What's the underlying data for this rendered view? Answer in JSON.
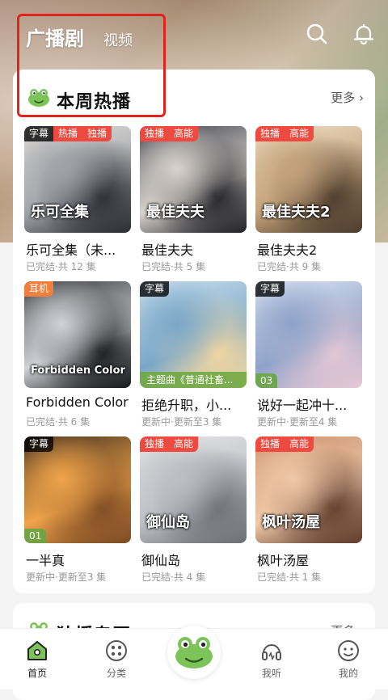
{
  "header": {
    "tab_active": "广播剧",
    "tab_other": "视频"
  },
  "section_hot": {
    "title": "本周热播",
    "more": "更多"
  },
  "section_next": {
    "title": "独播专区",
    "more": "更多"
  },
  "dramas": [
    {
      "title": "乐可全集（未...",
      "meta": "已完结·共 12 集",
      "tags": [
        {
          "text": "字幕",
          "color": "black"
        },
        {
          "text": "热播",
          "color": "red"
        },
        {
          "text": "独播",
          "color": "red"
        }
      ],
      "cover_text": "乐可全集",
      "art": [
        "#e9e4df",
        "#9fa3a8",
        "#2b2b33"
      ]
    },
    {
      "title": "最佳夫夫",
      "meta": "已完结·共 5 集",
      "tags": [
        {
          "text": "独播",
          "color": "red"
        },
        {
          "text": "高能",
          "color": "red"
        }
      ],
      "cover_text": "最佳夫夫",
      "art": [
        "#3b3f4a",
        "#d9d3cc",
        "#1f2026"
      ]
    },
    {
      "title": "最佳夫夫2",
      "meta": "已完结·共 9 集",
      "tags": [
        {
          "text": "独播",
          "color": "red"
        },
        {
          "text": "高能",
          "color": "red"
        }
      ],
      "cover_text": "最佳夫夫2",
      "art": [
        "#efe2c9",
        "#c4a27a",
        "#4a3b2c"
      ]
    },
    {
      "title": "Forbidden Color",
      "meta": "已完结·共 6 集",
      "tags": [
        {
          "text": "耳机",
          "color": "orange"
        }
      ],
      "cover_text": "Forbidden Color",
      "art": [
        "#2f2f33",
        "#cfd2d6",
        "#15161a"
      ]
    },
    {
      "title": "拒绝升职，小...",
      "meta": "更新中·更新至3 集",
      "tags": [
        {
          "text": "字幕",
          "color": "black"
        }
      ],
      "cover_text": "",
      "strip": "主题曲《普通社畜...",
      "art": [
        "#cfe3ef",
        "#7aa7c8",
        "#f6d8a0"
      ]
    },
    {
      "title": "说好一起冲十...",
      "meta": "更新中·更新至4 集",
      "tags": [
        {
          "text": "字幕",
          "color": "black"
        }
      ],
      "cover_text": "",
      "ep": "03",
      "art": [
        "#dfe6f3",
        "#8ea3c9",
        "#e7c8d6"
      ]
    },
    {
      "title": "一半真",
      "meta": "更新中·更新至3 集",
      "tags": [
        {
          "text": "字幕",
          "color": "black"
        }
      ],
      "cover_text": "",
      "ep": "01",
      "art": [
        "#3b2a1c",
        "#f0a44a",
        "#7c4a24"
      ]
    },
    {
      "title": "御仙岛",
      "meta": "已完结·共 4 集",
      "tags": [
        {
          "text": "独播",
          "color": "red"
        },
        {
          "text": "高能",
          "color": "red"
        }
      ],
      "cover_text": "御仙岛",
      "art": [
        "#e8e8ea",
        "#bdbfc4",
        "#6d6f75"
      ]
    },
    {
      "title": "枫叶汤屋",
      "meta": "已完结·共 1 集",
      "tags": [
        {
          "text": "独播",
          "color": "red"
        },
        {
          "text": "高能",
          "color": "red"
        }
      ],
      "cover_text": "枫叶汤屋",
      "art": [
        "#c98e6b",
        "#f0c9a8",
        "#5e3a2a"
      ]
    }
  ],
  "nav": [
    {
      "label": "首页",
      "icon": "home-icon"
    },
    {
      "label": "分类",
      "icon": "category-icon"
    },
    {
      "label": "",
      "icon": "frog-icon"
    },
    {
      "label": "我听",
      "icon": "headphones-icon"
    },
    {
      "label": "我的",
      "icon": "profile-icon"
    }
  ],
  "colors": {
    "highlight_box": "#e0241b",
    "tag_red": "#ee4a3f",
    "tag_orange": "#f07e3c",
    "frog_green": "#7cc35a"
  }
}
